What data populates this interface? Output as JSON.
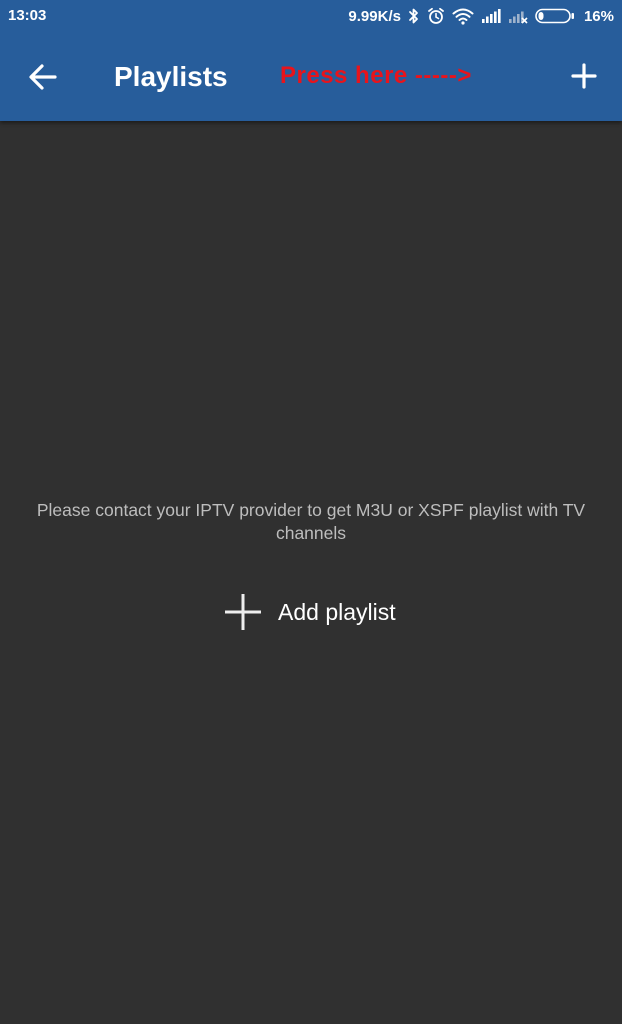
{
  "status_bar": {
    "time": "13:03",
    "network_speed": "9.99K/s",
    "battery_percent": "16%",
    "icons": [
      "bluetooth-icon",
      "alarm-icon",
      "wifi-icon",
      "signal-icon",
      "signal-no-service-icon",
      "battery-icon"
    ]
  },
  "app_bar": {
    "back_icon": "arrow-left-icon",
    "title": "Playlists",
    "annotation": "Press here ----->",
    "add_icon": "plus-icon",
    "background_color": "#275d9b",
    "annotation_color": "#e8141c"
  },
  "empty_state": {
    "message": "Please contact your IPTV provider to get M3U or XSPF playlist with TV channels",
    "add_playlist_icon": "plus-icon",
    "add_playlist_label": "Add playlist",
    "background_color": "#303030"
  }
}
